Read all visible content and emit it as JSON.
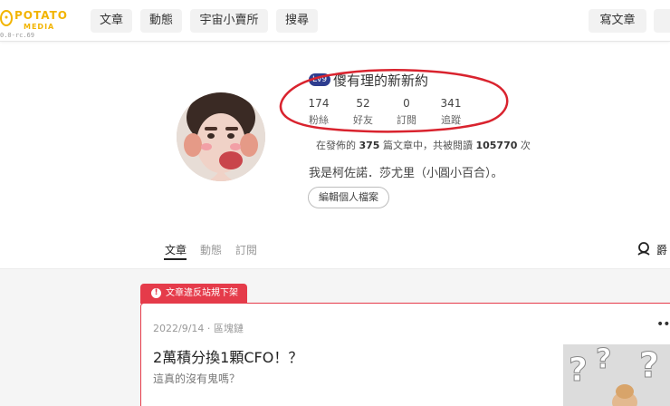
{
  "header": {
    "logo_text": "POTATO",
    "logo_sub": "MEDIA",
    "version": "0.0-rc.69",
    "nav": [
      "文章",
      "動態",
      "宇宙小賣所",
      "搜尋"
    ],
    "write_label": "寫文章"
  },
  "profile": {
    "level": "Lv9",
    "username": "傻有理的新新約",
    "stats": [
      {
        "value": "174",
        "label": "粉絲"
      },
      {
        "value": "52",
        "label": "好友"
      },
      {
        "value": "0",
        "label": "訂閱"
      },
      {
        "value": "341",
        "label": "追蹤"
      }
    ],
    "summary_prefix": "在發佈的",
    "article_count": "375",
    "summary_mid": "篇文章中，共被閱讀",
    "read_count": "105770",
    "summary_suffix": "次",
    "bio": "我是柯佐諾．莎尤里（小圓小百合）。",
    "edit_label": "編輯個人檔案"
  },
  "tabs": [
    "文章",
    "動態",
    "訂閱"
  ],
  "subscribe_label": "爵",
  "post": {
    "violation_label": "文章違反站規下架",
    "meta": "2022/9/14 · 區塊鏈",
    "title": "2萬積分換1顆CFO！？",
    "subtitle": "這真的沒有鬼嗎？",
    "more": "•••"
  },
  "colors": {
    "accent": "#f2b400",
    "violation": "#e53b4a",
    "annotation": "#d9232e",
    "level_badge": "#2e3d8f"
  },
  "icons": {
    "logo": "potato-logo-icon",
    "subscribe": "person-icon",
    "alert": "alert-circle-icon"
  }
}
